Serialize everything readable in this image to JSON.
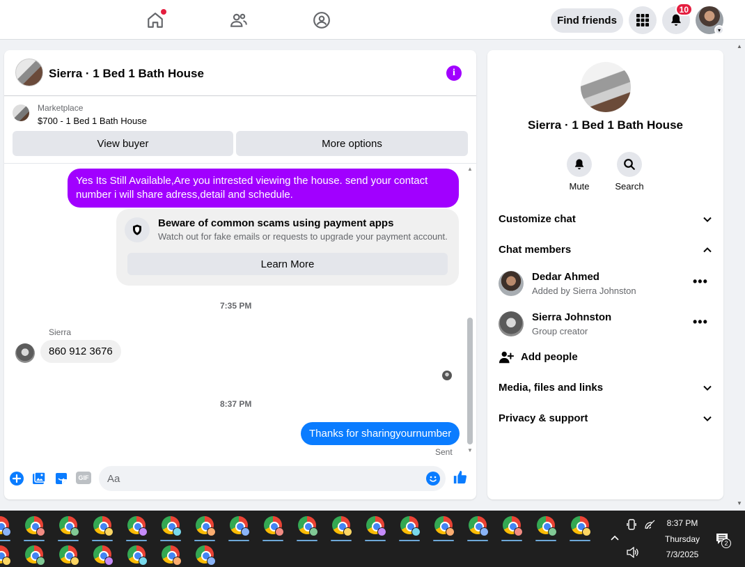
{
  "topbar": {
    "find_friends": "Find friends",
    "notifications_count": "10"
  },
  "chat": {
    "title": "Sierra · 1 Bed 1 Bath House",
    "marketplace_label": "Marketplace",
    "listing": "$700 - 1 Bed 1 Bath House",
    "view_buyer": "View buyer",
    "more_options": "More options",
    "messages": {
      "outgoing_1": "Yes Its Still Available,Are you intrested viewing the house. send your contact number i will share adress,detail and schedule.",
      "scam_title": "Beware of common scams using payment apps",
      "scam_sub": "Watch out for fake emails or requests to upgrade your payment account.",
      "learn_more": "Learn More",
      "time_1": "7:35 PM",
      "sender_name": "Sierra",
      "incoming_1": "860 912 3676",
      "time_2": "8:37 PM",
      "outgoing_2": "Thanks for sharingyournumber",
      "status": "Sent"
    },
    "composer": {
      "placeholder": "Aa",
      "gif_label": "GIF"
    }
  },
  "side": {
    "title": "Sierra · 1 Bed 1 Bath House",
    "mute": "Mute",
    "search": "Search",
    "customize_chat": "Customize chat",
    "chat_members": "Chat members",
    "members": [
      {
        "name": "Dedar Ahmed",
        "sub": "Added by Sierra Johnston"
      },
      {
        "name": "Sierra Johnston",
        "sub": "Group creator"
      }
    ],
    "add_people": "Add people",
    "media_files_links": "Media, files and links",
    "privacy_support": "Privacy & support"
  },
  "taskbar": {
    "time": "8:37 PM",
    "day": "Thursday",
    "date": "7/3/2025",
    "notifications": "2"
  },
  "colors": {
    "accent_purple": "#a100ff",
    "accent_blue": "#0a7cff",
    "notification_red": "#e41e3f"
  }
}
